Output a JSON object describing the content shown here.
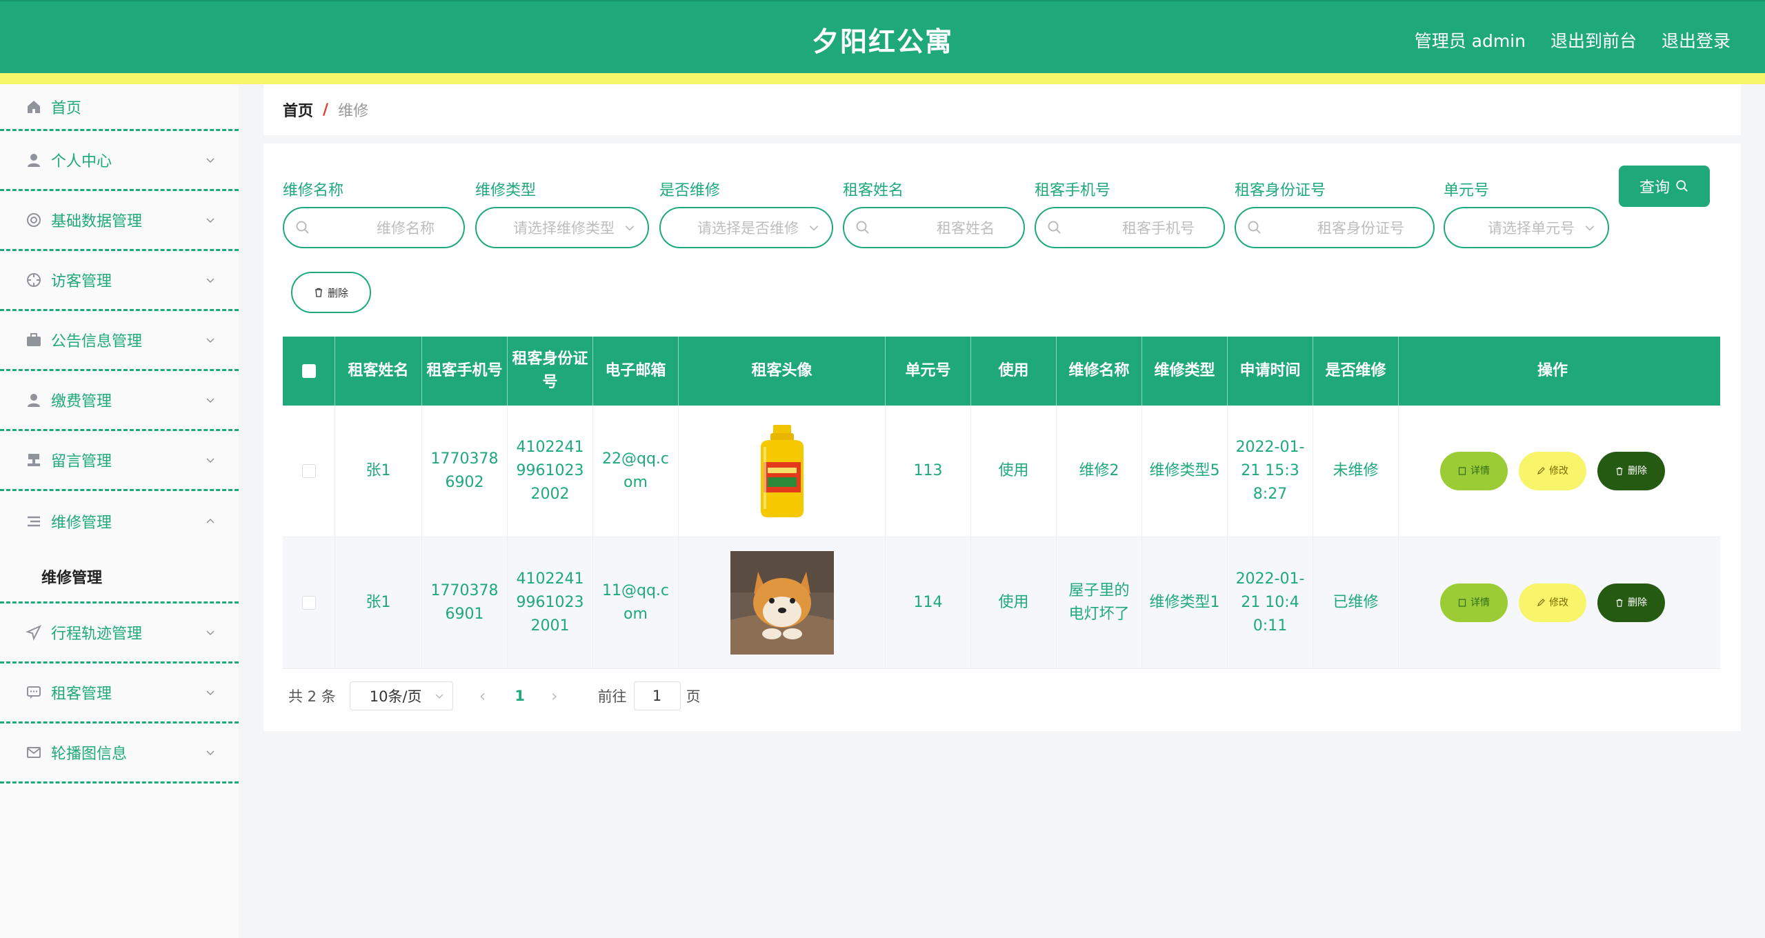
{
  "header": {
    "title": "夕阳红公寓",
    "admin_label": "管理员 admin",
    "to_front": "退出到前台",
    "logout": "退出登录"
  },
  "sidebar": {
    "items": [
      {
        "label": "首页",
        "icon": "home-icon"
      },
      {
        "label": "个人中心",
        "icon": "user-icon"
      },
      {
        "label": "基础数据管理",
        "icon": "database-icon"
      },
      {
        "label": "访客管理",
        "icon": "crosshair-icon"
      },
      {
        "label": "公告信息管理",
        "icon": "briefcase-icon"
      },
      {
        "label": "缴费管理",
        "icon": "user-icon"
      },
      {
        "label": "留言管理",
        "icon": "stamp-icon"
      },
      {
        "label": "维修管理",
        "icon": "list-icon"
      },
      {
        "label": "行程轨迹管理",
        "icon": "send-icon"
      },
      {
        "label": "租客管理",
        "icon": "chat-icon"
      },
      {
        "label": "轮播图信息",
        "icon": "mail-icon"
      }
    ],
    "sub_item": "维修管理"
  },
  "breadcrumb": {
    "home": "首页",
    "sep": "/",
    "current": "维修"
  },
  "filters": {
    "name_label": "维修名称",
    "name_ph": "维修名称",
    "type_label": "维修类型",
    "type_ph": "请选择维修类型",
    "repaired_label": "是否维修",
    "repaired_ph": "请选择是否维修",
    "tenant_label": "租客姓名",
    "tenant_ph": "租客姓名",
    "phone_label": "租客手机号",
    "phone_ph": "租客手机号",
    "idcard_label": "租客身份证号",
    "idcard_ph": "租客身份证号",
    "unit_label": "单元号",
    "unit_ph": "请选择单元号",
    "query_label": "查询",
    "delete_label": "删除"
  },
  "table": {
    "headers": [
      "租客姓名",
      "租客手机号",
      "租客身份证号",
      "电子邮箱",
      "租客头像",
      "单元号",
      "使用",
      "维修名称",
      "维修类型",
      "申请时间",
      "是否维修",
      "操作"
    ],
    "rows": [
      {
        "name": "张1",
        "phone": "17703786902",
        "idcard": "410224199610232002",
        "email": "22@qq.com",
        "avatar": "oil-bottle-image",
        "unit": "113",
        "use": "使用",
        "repair_name": "维修2",
        "repair_type": "维修类型5",
        "time": "2022-01-21 15:38:27",
        "status": "未维修"
      },
      {
        "name": "张1",
        "phone": "17703786901",
        "idcard": "410224199610232001",
        "email": "11@qq.com",
        "avatar": "shiba-dog-image",
        "unit": "114",
        "use": "使用",
        "repair_name": "屋子里的电灯坏了",
        "repair_type": "维修类型1",
        "time": "2022-01-21 10:40:11",
        "status": "已维修"
      }
    ],
    "op_detail": "详情",
    "op_edit": "修改",
    "op_delete": "删除"
  },
  "pager": {
    "total": "共 2 条",
    "page_size": "10条/页",
    "current": "1",
    "goto_label": "前往",
    "goto_value": "1",
    "page_unit": "页"
  },
  "colors": {
    "primary": "#1fa97a",
    "stripe": "#f7f56a",
    "detail": "#9bcc36",
    "edit": "#f8f56a",
    "delete": "#245a12"
  }
}
